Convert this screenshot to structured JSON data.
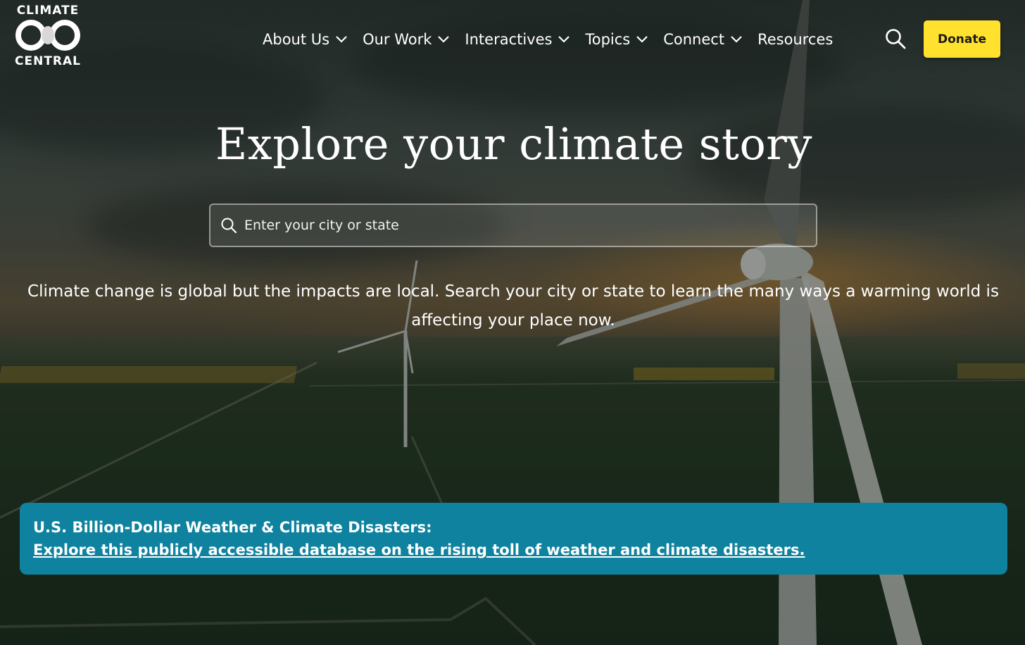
{
  "header": {
    "logo": {
      "line_top": "CLIMATE",
      "line_bottom": "CENTRAL"
    },
    "nav": [
      {
        "label": "About Us",
        "has_dropdown": true,
        "icon": "chevron-down-icon"
      },
      {
        "label": "Our Work",
        "has_dropdown": true,
        "icon": "chevron-down-icon"
      },
      {
        "label": "Interactives",
        "has_dropdown": true,
        "icon": "chevron-down-icon"
      },
      {
        "label": "Topics",
        "has_dropdown": true,
        "icon": "chevron-down-icon"
      },
      {
        "label": "Connect",
        "has_dropdown": true,
        "icon": "chevron-down-icon"
      },
      {
        "label": "Resources",
        "has_dropdown": false
      }
    ],
    "search_icon": "search-icon",
    "donate_label": "Donate"
  },
  "hero": {
    "title": "Explore your climate story",
    "search": {
      "placeholder": "Enter your city or state",
      "value": "",
      "icon": "search-icon"
    },
    "description": "Climate change is global but the impacts are local. Search your city or state to learn the many ways a warming world is affecting your place now."
  },
  "banner": {
    "title": "U.S. Billion-Dollar Weather & Climate Disasters:",
    "link_text": "Explore this publicly accessible database on the rising toll of weather and climate disasters."
  },
  "colors": {
    "donate_bg": "#ffe12e",
    "banner_bg": "#0e829f",
    "text": "#ffffff"
  }
}
